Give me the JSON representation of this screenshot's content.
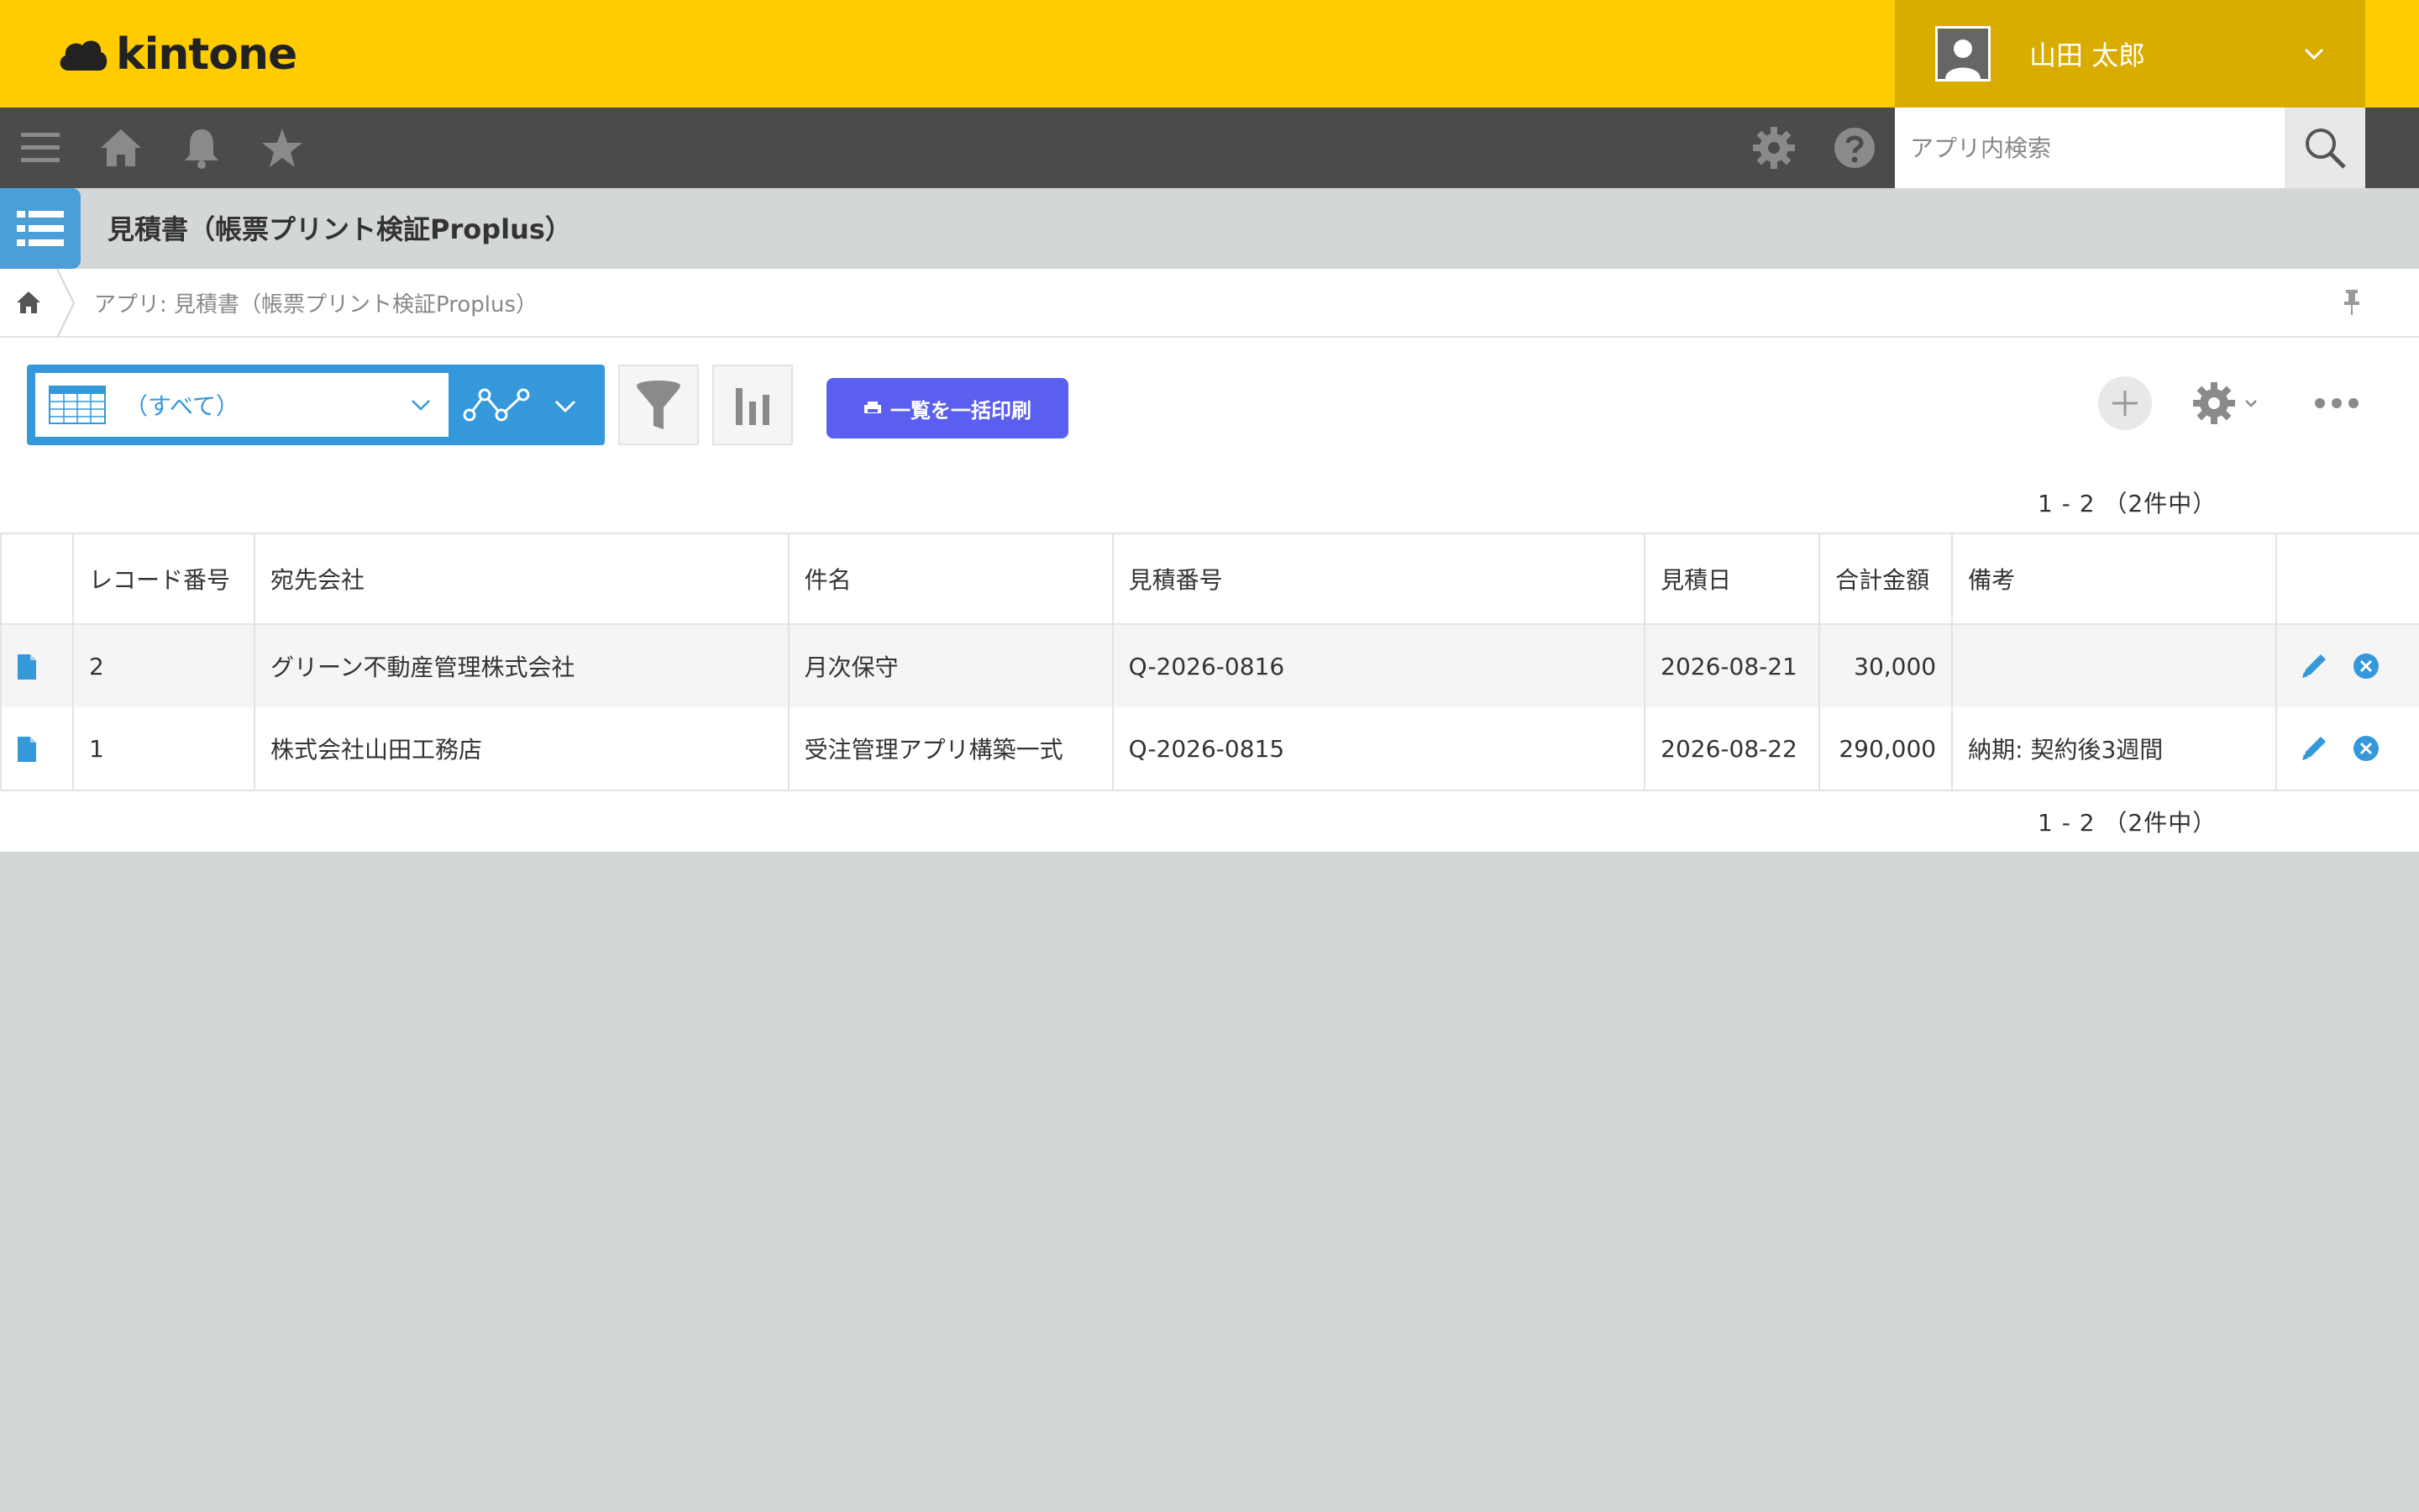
{
  "brand": {
    "name": "kintone"
  },
  "user": {
    "name": "山田 太郎"
  },
  "search": {
    "placeholder": "アプリ内検索"
  },
  "app": {
    "title": "見積書（帳票プリント検証Proplus）"
  },
  "breadcrumb": {
    "text": "アプリ: 見積書（帳票プリント検証Proplus）"
  },
  "view": {
    "selected": "（すべて）"
  },
  "toolbar": {
    "print_label": "一覧を一括印刷"
  },
  "pager": {
    "text": "1 - 2 （2件中）"
  },
  "table": {
    "columns": [
      "レコード番号",
      "宛先会社",
      "件名",
      "見積番号",
      "見積日",
      "合計金額",
      "備考"
    ],
    "rows": [
      {
        "id": "2",
        "company": "グリーン不動産管理株式会社",
        "subject": "月次保守",
        "quote_no": "Q-2026-0816",
        "date": "2026-08-21",
        "total": "30,000",
        "note": ""
      },
      {
        "id": "1",
        "company": "株式会社山田工務店",
        "subject": "受注管理アプリ構築一式",
        "quote_no": "Q-2026-0815",
        "date": "2026-08-22",
        "total": "290,000",
        "note": "納期: 契約後3週間"
      }
    ]
  },
  "colors": {
    "header_bg": "#ffcc00",
    "user_menu_bg": "#d9ac00",
    "nav_bg": "#4b4b4b",
    "accent": "#3498db",
    "print_button": "#5b5ff0",
    "page_bg": "#d4d7d8"
  },
  "icons": {
    "nav": [
      "menu-icon",
      "home-icon",
      "bell-icon",
      "star-icon",
      "gear-icon",
      "help-icon",
      "search-icon"
    ],
    "row": [
      "document-icon",
      "pencil-icon",
      "close-circle-icon"
    ]
  }
}
